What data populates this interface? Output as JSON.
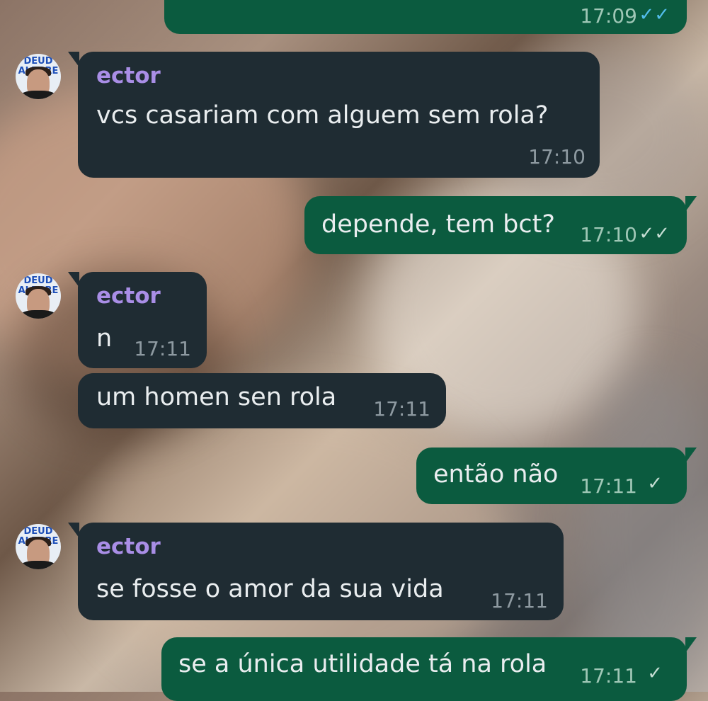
{
  "messages": [
    {
      "type": "out",
      "text": "",
      "time": "17:09",
      "status": "read"
    },
    {
      "type": "in",
      "sender": "ector",
      "text": "vcs casariam com alguem sem rola?",
      "time": "17:10"
    },
    {
      "type": "out",
      "text": "depende, tem bct?",
      "time": "17:10",
      "status": "sent"
    },
    {
      "type": "in",
      "sender": "ector",
      "text": "n",
      "time": "17:11"
    },
    {
      "type": "in",
      "text": "um homen sen rola",
      "time": "17:11"
    },
    {
      "type": "out",
      "text": "então não",
      "time": "17:11",
      "status": "sent"
    },
    {
      "type": "in",
      "sender": "ector",
      "text": "se fosse o amor da sua vida",
      "time": "17:11"
    },
    {
      "type": "out",
      "text": "se a única utilidade tá na rola",
      "time": "17:11",
      "status": "sent"
    }
  ],
  "avatar_sign_text": "DEUD ALEGRE",
  "icons": {
    "double_check": "double-check-icon",
    "single_check": "single-check-icon"
  },
  "colors": {
    "incoming_bubble": "#1f2c33",
    "outgoing_bubble": "#0b5b3f",
    "sender_name": "#a98ee6",
    "read_tick": "#53bdeb"
  }
}
